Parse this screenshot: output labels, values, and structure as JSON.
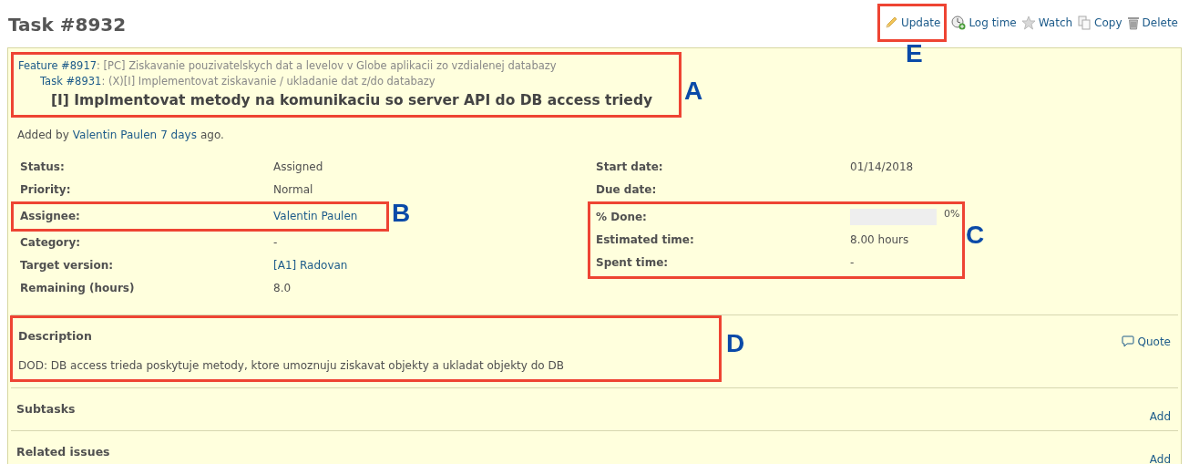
{
  "title": "Task #8932",
  "actions": [
    "Update",
    "Log time",
    "Watch",
    "Copy",
    "Delete"
  ],
  "parents": [
    {
      "link": "Feature #8917",
      "text": ": [PC] Ziskavanie pouzivatelskych dat a levelov v Globe aplikacii zo vzdialenej databazy"
    },
    {
      "link": "Task #8931",
      "text": ": (X)[I] Implementovat ziskavanie / ukladanie dat z/do databazy"
    }
  ],
  "subject": "[I] Implmentovat metody na komunikaciu so server API do DB access triedy",
  "added": {
    "prefix": "Added by",
    "author": "Valentin Paulen",
    "age": "7 days",
    "suffix": "ago."
  },
  "attributes_left": [
    {
      "label": "Status:",
      "value": "Assigned",
      "kind": "text"
    },
    {
      "label": "Priority:",
      "value": "Normal",
      "kind": "text"
    },
    {
      "label": "Assignee:",
      "value": "Valentin Paulen",
      "kind": "link"
    },
    {
      "label": "Category:",
      "value": "-",
      "kind": "text"
    },
    {
      "label": "Target version:",
      "value": "[A1] Radovan",
      "kind": "link"
    },
    {
      "label": "Remaining (hours)",
      "value": "8.0",
      "kind": "text"
    }
  ],
  "attributes_right": [
    {
      "label": "Start date:",
      "value": "01/14/2018",
      "kind": "text"
    },
    {
      "label": "Due date:",
      "kind": "text"
    },
    {
      "label": "% Done:",
      "value": "0%",
      "kind": "progress"
    },
    {
      "label": "Estimated time:",
      "value": "8.00 hours",
      "kind": "text"
    },
    {
      "label": "Spent time:",
      "value": "-",
      "kind": "text"
    }
  ],
  "description": {
    "heading": "Description",
    "text": "DOD: DB access trieda poskytuje metody, ktore umoznuju ziskavat objekty a ukladat objekty do DB",
    "quote": "Quote"
  },
  "sections": [
    {
      "heading": "Subtasks",
      "action": "Add"
    },
    {
      "heading": "Related issues",
      "action": "Add"
    }
  ],
  "annotations": [
    "A",
    "B",
    "C",
    "D",
    "E"
  ]
}
